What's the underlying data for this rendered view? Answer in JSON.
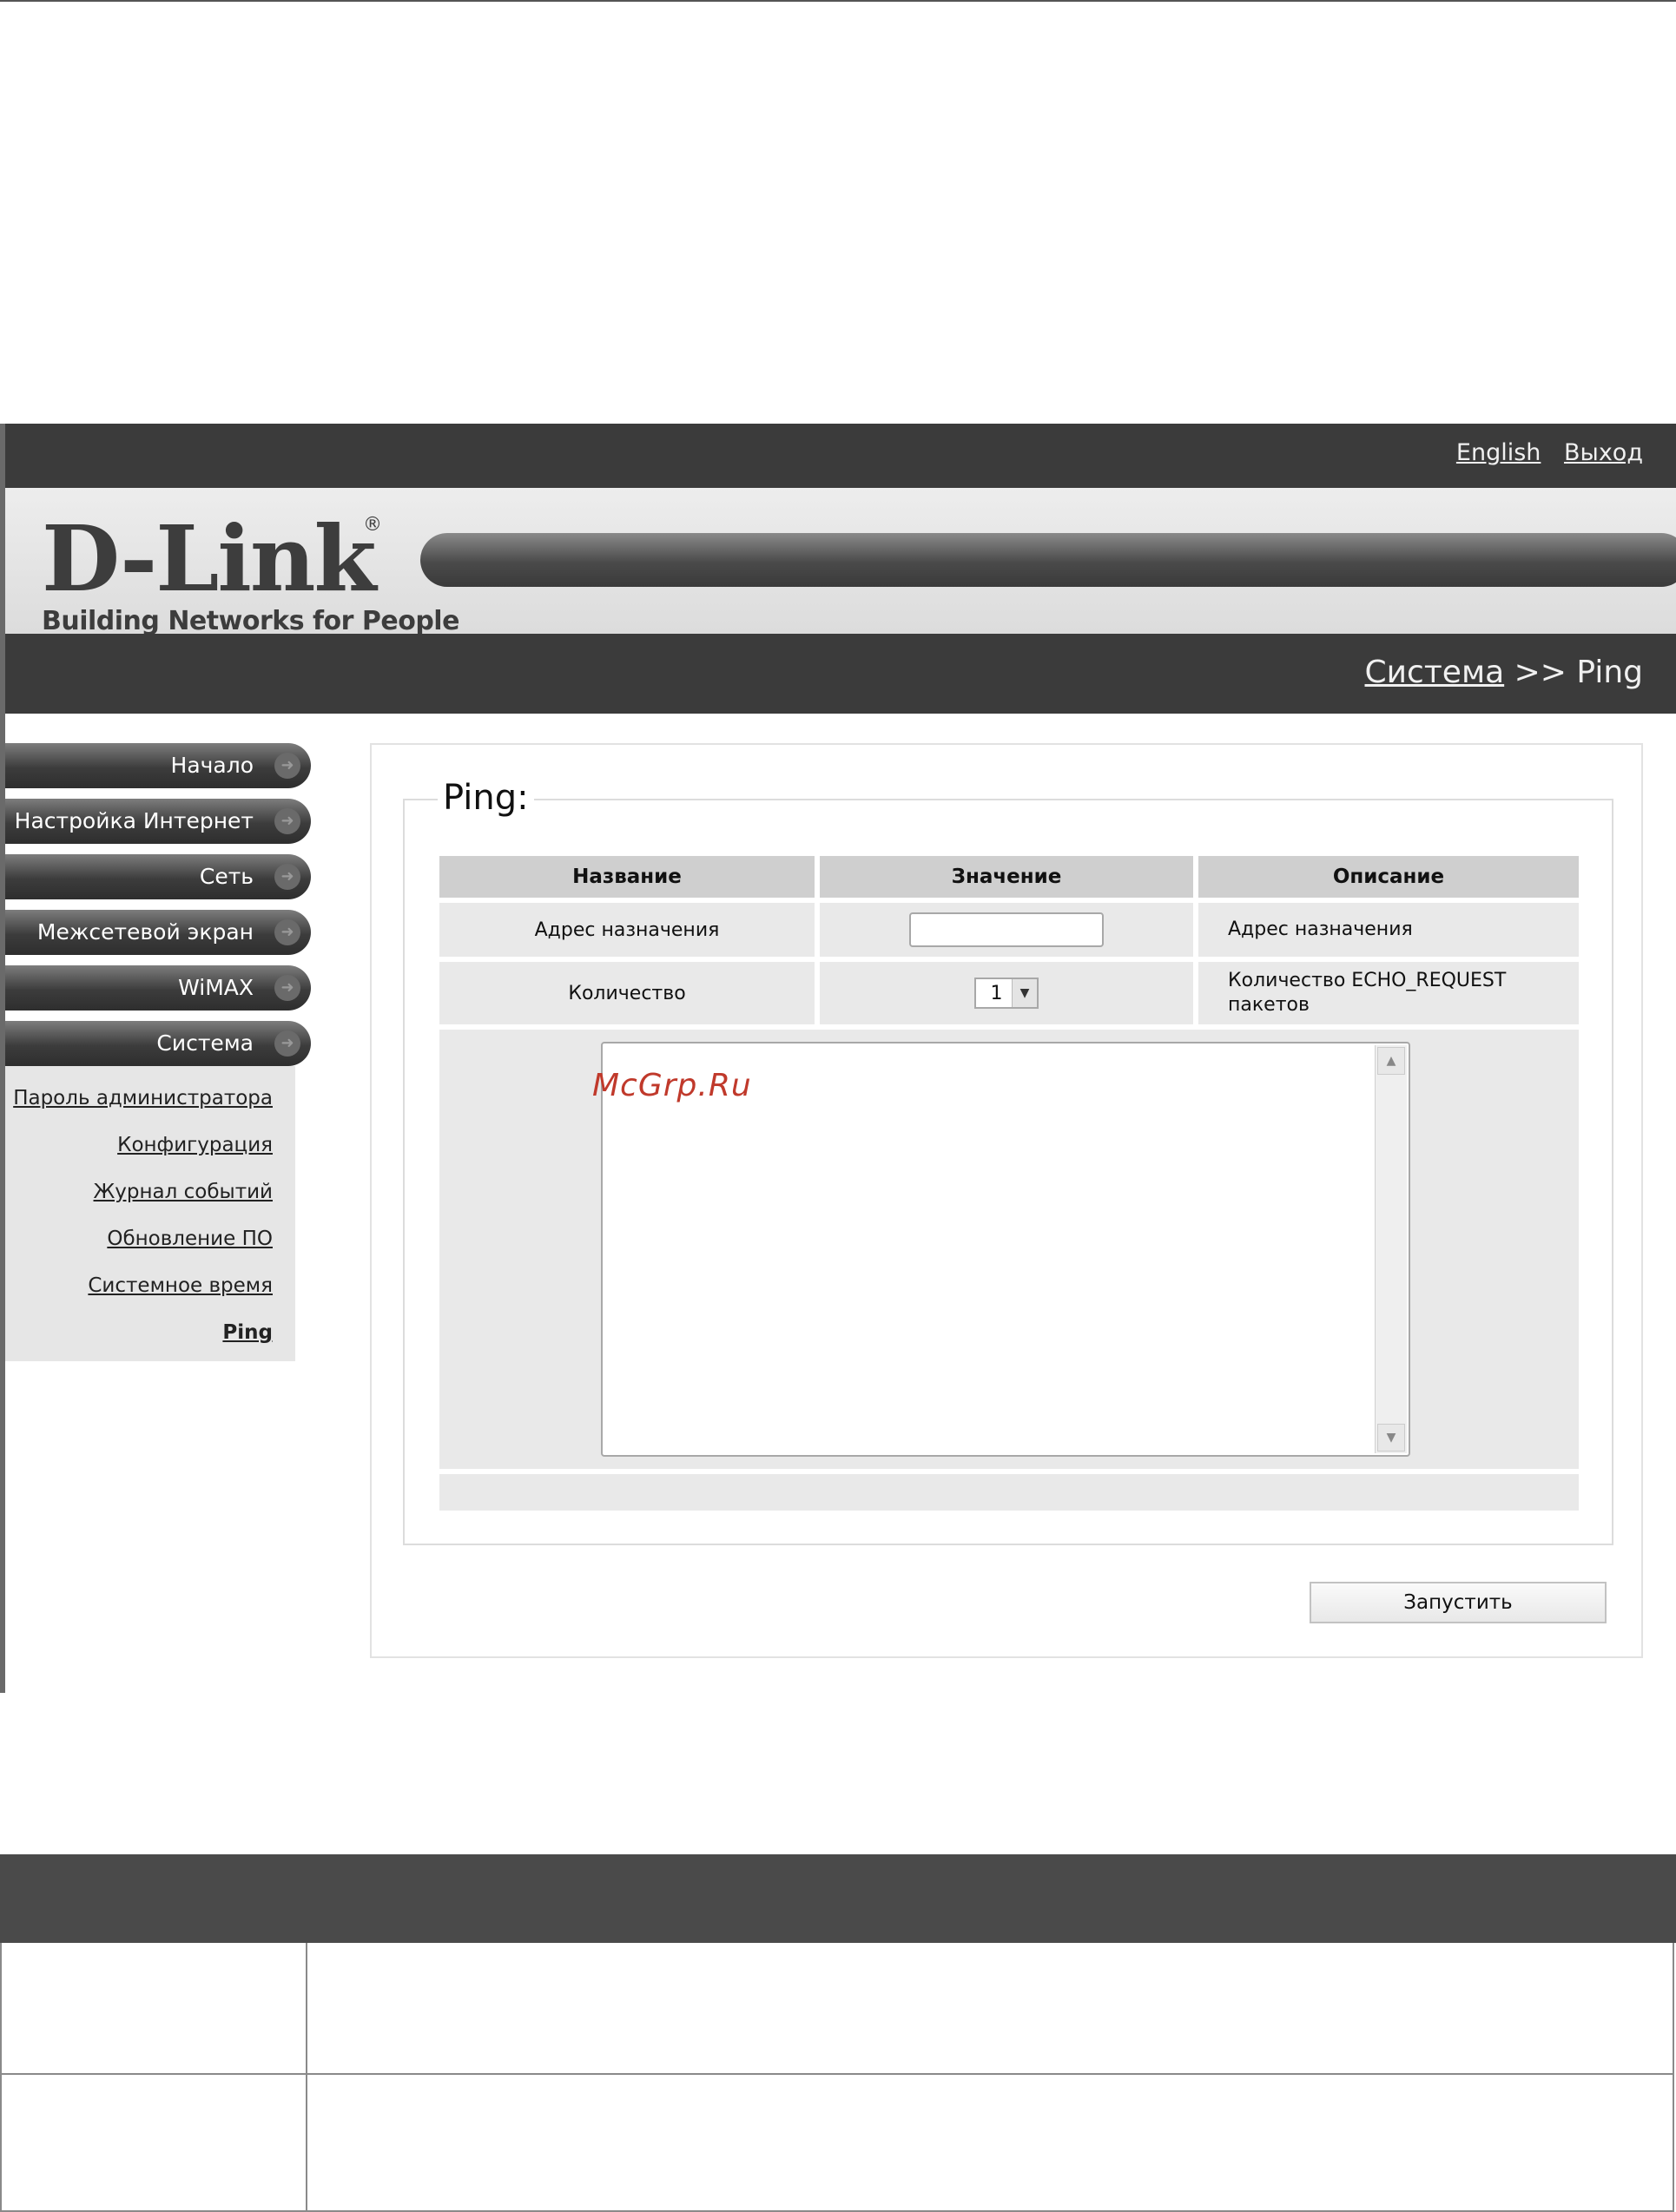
{
  "header": {
    "links": [
      "English",
      "Выход"
    ],
    "logo_main": "D-Link",
    "logo_reg": "®",
    "logo_tagline": "Building Networks for People"
  },
  "breadcrumb": {
    "section": "Система",
    "separator": ">>",
    "page": "Ping"
  },
  "sidebar": {
    "items": [
      {
        "label": "Начало"
      },
      {
        "label": "Настройка Интернет"
      },
      {
        "label": "Сеть"
      },
      {
        "label": "Межсетевой экран"
      },
      {
        "label": "WiMAX"
      },
      {
        "label": "Система"
      }
    ],
    "submenu": [
      {
        "label": "Пароль администратора"
      },
      {
        "label": "Конфигурация"
      },
      {
        "label": "Журнал событий"
      },
      {
        "label": "Обновление ПО"
      },
      {
        "label": "Системное время"
      },
      {
        "label": "Ping"
      }
    ]
  },
  "form": {
    "title": "Ping:",
    "columns": [
      "Название",
      "Значение",
      "Описание"
    ],
    "rows": [
      {
        "name": "Адрес назначения",
        "value": "",
        "description": "Адрес назначения"
      },
      {
        "name": "Количество",
        "value": "1",
        "description": "Количество ECHO_REQUEST пакетов"
      }
    ],
    "output_text": "",
    "run_button": "Запустить"
  },
  "watermark": "McGrp.Ru",
  "icons": {
    "menu_arrow": "arrow-right-icon",
    "select_arrow": "triangle-down-icon",
    "scroll_up": "triangle-up-icon",
    "scroll_down": "triangle-down-icon"
  }
}
